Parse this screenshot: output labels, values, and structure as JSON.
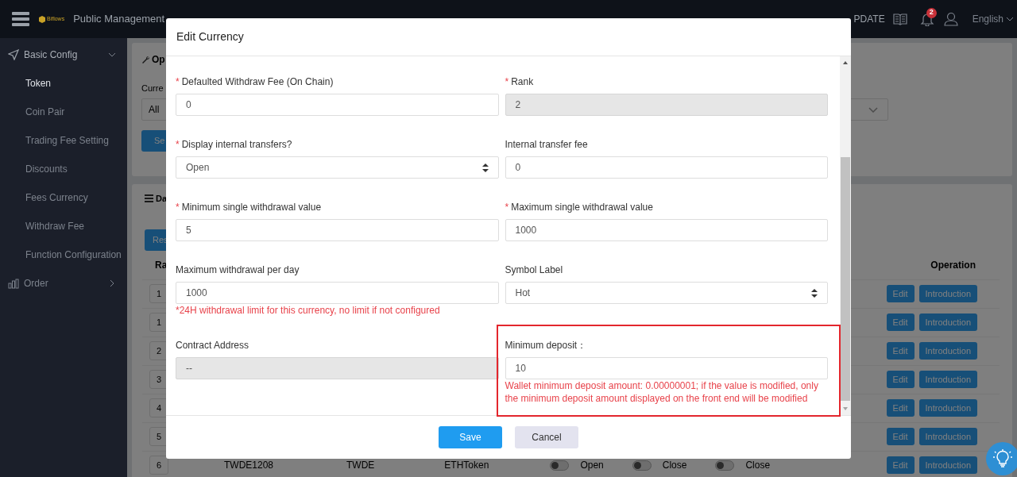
{
  "header": {
    "logo": "Biflows",
    "nav_items": [
      "Public Management",
      "PDATE"
    ],
    "notification_count": "2",
    "language": "English"
  },
  "sidebar": {
    "items": [
      {
        "label": "Basic Config",
        "expanded": true,
        "children": [
          {
            "label": "Token",
            "selected": true
          },
          {
            "label": "Coin Pair",
            "selected": false
          },
          {
            "label": "Trading Fee Setting",
            "selected": false
          },
          {
            "label": "Discounts",
            "selected": false
          },
          {
            "label": "Fees Currency",
            "selected": false
          },
          {
            "label": "Withdraw Fee",
            "selected": false
          },
          {
            "label": "Function Configuration",
            "selected": false
          }
        ]
      },
      {
        "label": "Order",
        "expanded": false
      }
    ]
  },
  "filter_card": {
    "title": "Op",
    "field_label": "Curre",
    "select_value": "All",
    "button": "Se"
  },
  "data_card": {
    "title": "Da",
    "button": "Res",
    "table": {
      "columns": [
        "Ra",
        "Operation"
      ],
      "rows": [
        {
          "rank": "1",
          "actions": [
            "Edit",
            "Introduction"
          ]
        },
        {
          "rank": "1",
          "actions": [
            "Edit",
            "Introduction"
          ]
        },
        {
          "rank": "2",
          "actions": [
            "Edit",
            "Introduction"
          ]
        },
        {
          "rank": "3",
          "actions": [
            "Edit",
            "Introduction"
          ]
        },
        {
          "rank": "4",
          "actions": [
            "Edit",
            "Introduction"
          ]
        },
        {
          "rank": "5",
          "actions": [
            "Edit",
            "Introduction"
          ]
        },
        {
          "rank": "6",
          "code": "TWDE1208",
          "symbol": "TWDE",
          "chain": "ETHToken",
          "switches": [
            {
              "on": false,
              "label": "Open"
            },
            {
              "on": false,
              "label": "Close"
            },
            {
              "on": false,
              "label": "Close"
            }
          ],
          "actions": [
            "Edit",
            "Introduction"
          ]
        }
      ]
    }
  },
  "modal": {
    "title": "Edit Currency",
    "fields": [
      {
        "label": "Defaulted Withdraw Fee (On Chain)",
        "marker": "*",
        "kind": "input",
        "value": "0",
        "disabled": false,
        "highlighted": false
      },
      {
        "label": "Rank",
        "marker": "*",
        "kind": "input",
        "value": "2",
        "disabled": true,
        "highlighted": false
      },
      {
        "label": "Display internal transfers?",
        "marker": "*",
        "kind": "select",
        "value": "Open",
        "disabled": false,
        "highlighted": false
      },
      {
        "label": "Internal transfer fee",
        "kind": "input",
        "value": "0",
        "disabled": false,
        "highlighted": false
      },
      {
        "label": "Minimum single withdrawal value",
        "marker": "*",
        "kind": "input",
        "value": "5",
        "disabled": false,
        "highlighted": false
      },
      {
        "label": "Maximum single withdrawal value",
        "marker": "*",
        "kind": "input",
        "value": "1000",
        "disabled": false,
        "highlighted": false
      },
      {
        "label": "Maximum withdrawal per day",
        "kind": "input",
        "value": "1000",
        "disabled": false,
        "highlighted": false,
        "help": "*24H withdrawal limit for this currency, no limit if not configured"
      },
      {
        "label": "Symbol Label",
        "kind": "select",
        "value": "Hot",
        "disabled": false,
        "highlighted": false
      },
      {
        "label": "Contract Address",
        "kind": "input",
        "value": "--",
        "disabled": true,
        "highlighted": false
      },
      {
        "label": "Minimum deposit：",
        "kind": "input",
        "value": "10",
        "disabled": false,
        "highlighted": true,
        "help": "Wallet minimum deposit amount: 0.00000001; if the value is modified, only the minimum deposit amount displayed on the front end will be modified"
      }
    ],
    "buttons": [
      {
        "label": "Save",
        "kind": "primary"
      },
      {
        "label": "Cancel",
        "kind": "secondary"
      }
    ]
  }
}
